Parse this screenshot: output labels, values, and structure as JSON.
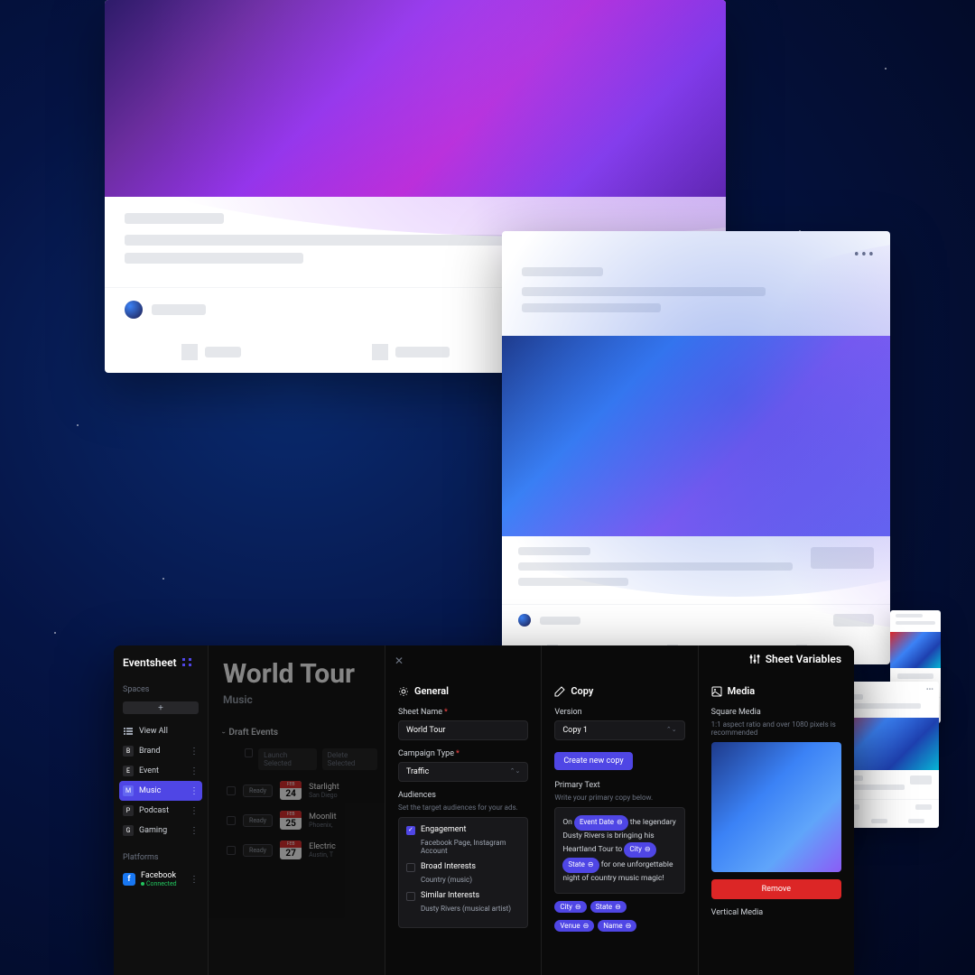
{
  "eventsheet": {
    "app_name": "Eventsheet",
    "sidebar": {
      "spaces_label": "Spaces",
      "add_label": "+",
      "view_all": "View All",
      "items": [
        {
          "icon": "B",
          "label": "Brand"
        },
        {
          "icon": "E",
          "label": "Event"
        },
        {
          "icon": "M",
          "label": "Music"
        },
        {
          "icon": "P",
          "label": "Podcast"
        },
        {
          "icon": "G",
          "label": "Gaming"
        }
      ],
      "platforms_label": "Platforms",
      "platform": {
        "name": "Facebook",
        "status": "Connected"
      }
    },
    "content": {
      "title": "World Tour",
      "subtitle": "Music",
      "draft_header": "Draft Events",
      "toolbar": {
        "launch": "Launch Selected",
        "delete": "Delete Selected"
      },
      "events": [
        {
          "status": "Ready",
          "month": "FEB",
          "day": "24",
          "name": "Starlight",
          "location": "San Diego"
        },
        {
          "status": "Ready",
          "month": "FEB",
          "day": "25",
          "name": "Moonlit",
          "location": "Phoenix,"
        },
        {
          "status": "Ready",
          "month": "FEB",
          "day": "27",
          "name": "Electric",
          "location": "Austin, T"
        }
      ]
    },
    "panel": {
      "title": "Sheet Variables",
      "general": {
        "header": "General",
        "sheet_name_label": "Sheet Name",
        "sheet_name_value": "World Tour",
        "campaign_type_label": "Campaign Type",
        "campaign_type_value": "Traffic",
        "audiences_label": "Audiences",
        "audiences_hint": "Set the target audiences for your ads.",
        "audience_items": [
          {
            "checked": true,
            "label": "Engagement",
            "sub": "Facebook Page, Instagram Account"
          },
          {
            "checked": false,
            "label": "Broad Interests",
            "sub": "Country (music)"
          },
          {
            "checked": false,
            "label": "Similar Interests",
            "sub": "Dusty Rivers (musical artist)"
          }
        ]
      },
      "copy": {
        "header": "Copy",
        "version_label": "Version",
        "version_value": "Copy 1",
        "create_copy": "Create new copy",
        "primary_text_label": "Primary Text",
        "primary_text_hint": "Write your primary copy below.",
        "text_parts": {
          "p1": "On",
          "p2": "the legendary Dusty Rivers is bringing his Heartland Tour to",
          "p3": "for one unforgettable night of country music magic!"
        },
        "vars": {
          "event_date": "Event Date",
          "city": "City",
          "state": "State",
          "venue": "Venue",
          "name": "Name"
        }
      },
      "media": {
        "header": "Media",
        "square_label": "Square Media",
        "square_hint": "1:1 aspect ratio and over 1080 pixels is recommended",
        "remove": "Remove",
        "vertical_label": "Vertical Media"
      }
    }
  }
}
